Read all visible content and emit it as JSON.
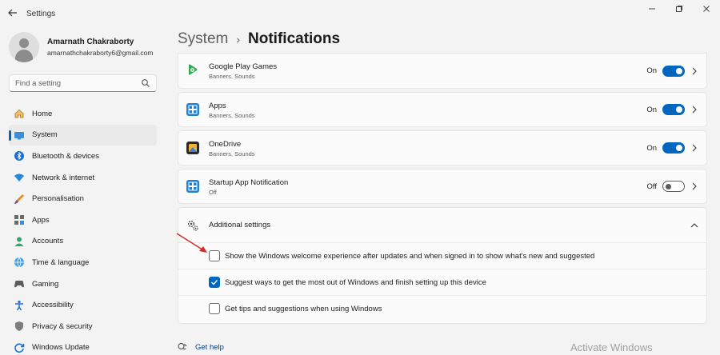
{
  "window": {
    "title": "Settings",
    "controls": [
      "minimize-icon",
      "maximize-icon",
      "close-icon"
    ]
  },
  "profile": {
    "name": "Amarnath Chakraborty",
    "email": "amarnathchakraborty6@gmail.com"
  },
  "search": {
    "placeholder": "Find a setting"
  },
  "nav": {
    "items": [
      {
        "label": "Home",
        "icon": "home-icon"
      },
      {
        "label": "System",
        "icon": "system-icon",
        "active": true
      },
      {
        "label": "Bluetooth & devices",
        "icon": "bluetooth-icon"
      },
      {
        "label": "Network & internet",
        "icon": "wifi-icon"
      },
      {
        "label": "Personalisation",
        "icon": "brush-icon"
      },
      {
        "label": "Apps",
        "icon": "apps-icon"
      },
      {
        "label": "Accounts",
        "icon": "accounts-icon"
      },
      {
        "label": "Time & language",
        "icon": "globe-icon"
      },
      {
        "label": "Gaming",
        "icon": "gamepad-icon"
      },
      {
        "label": "Accessibility",
        "icon": "accessibility-icon"
      },
      {
        "label": "Privacy & security",
        "icon": "shield-icon"
      },
      {
        "label": "Windows Update",
        "icon": "update-icon"
      }
    ]
  },
  "breadcrumb": {
    "parent": "System",
    "separator": "›",
    "current": "Notifications"
  },
  "apps": [
    {
      "name": "Google Play Games",
      "sub": "Banners, Sounds",
      "state_label": "On",
      "on": true,
      "icon": "google-play-games-icon"
    },
    {
      "name": "Apps",
      "sub": "Banners, Sounds",
      "state_label": "On",
      "on": true,
      "icon": "apps-app-icon"
    },
    {
      "name": "OneDrive",
      "sub": "Banners, Sounds",
      "state_label": "On",
      "on": true,
      "icon": "onedrive-icon"
    },
    {
      "name": "Startup App Notification",
      "sub": "Off",
      "state_label": "Off",
      "on": false,
      "icon": "startup-app-icon"
    }
  ],
  "additional": {
    "title": "Additional settings",
    "options": [
      {
        "label": "Show the Windows welcome experience after updates and when signed in to show what's new and suggested",
        "checked": false
      },
      {
        "label": "Suggest ways to get the most out of Windows and finish setting up this device",
        "checked": true
      },
      {
        "label": "Get tips and suggestions when using Windows",
        "checked": false
      }
    ]
  },
  "help": {
    "label": "Get help"
  },
  "watermark": "Activate Windows",
  "colors": {
    "accent": "#0067c0",
    "arrow": "#d22b2b",
    "background": "#f3f3f3",
    "card": "#fbfbfb"
  }
}
